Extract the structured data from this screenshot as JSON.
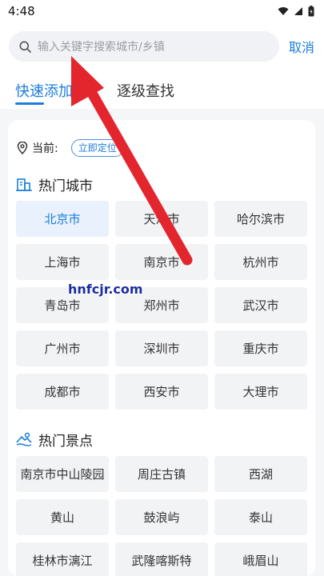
{
  "status": {
    "time": "4:48"
  },
  "search": {
    "placeholder": "输入关键字搜索城市/乡镇",
    "cancel_label": "取消"
  },
  "tabs": [
    {
      "label": "快速添加",
      "active": true
    },
    {
      "label": "逐级查找",
      "active": false
    }
  ],
  "location": {
    "label": "当前:",
    "locate_label": "立即定位"
  },
  "hot_cities": {
    "title": "热门城市",
    "items": [
      "北京市",
      "天津市",
      "哈尔滨市",
      "上海市",
      "南京市",
      "杭州市",
      "青岛市",
      "郑州市",
      "武汉市",
      "广州市",
      "深圳市",
      "重庆市",
      "成都市",
      "西安市",
      "大理市"
    ]
  },
  "hot_spots": {
    "title": "热门景点",
    "items": [
      "南京市中山陵园",
      "周庄古镇",
      "西湖",
      "黄山",
      "鼓浪屿",
      "泰山",
      "桂林市漓江",
      "武隆喀斯特",
      "峨眉山"
    ]
  },
  "watermark": "hnfcjr.com",
  "colors": {
    "accent": "#1c7ddb",
    "arrow": "#e3262e"
  }
}
